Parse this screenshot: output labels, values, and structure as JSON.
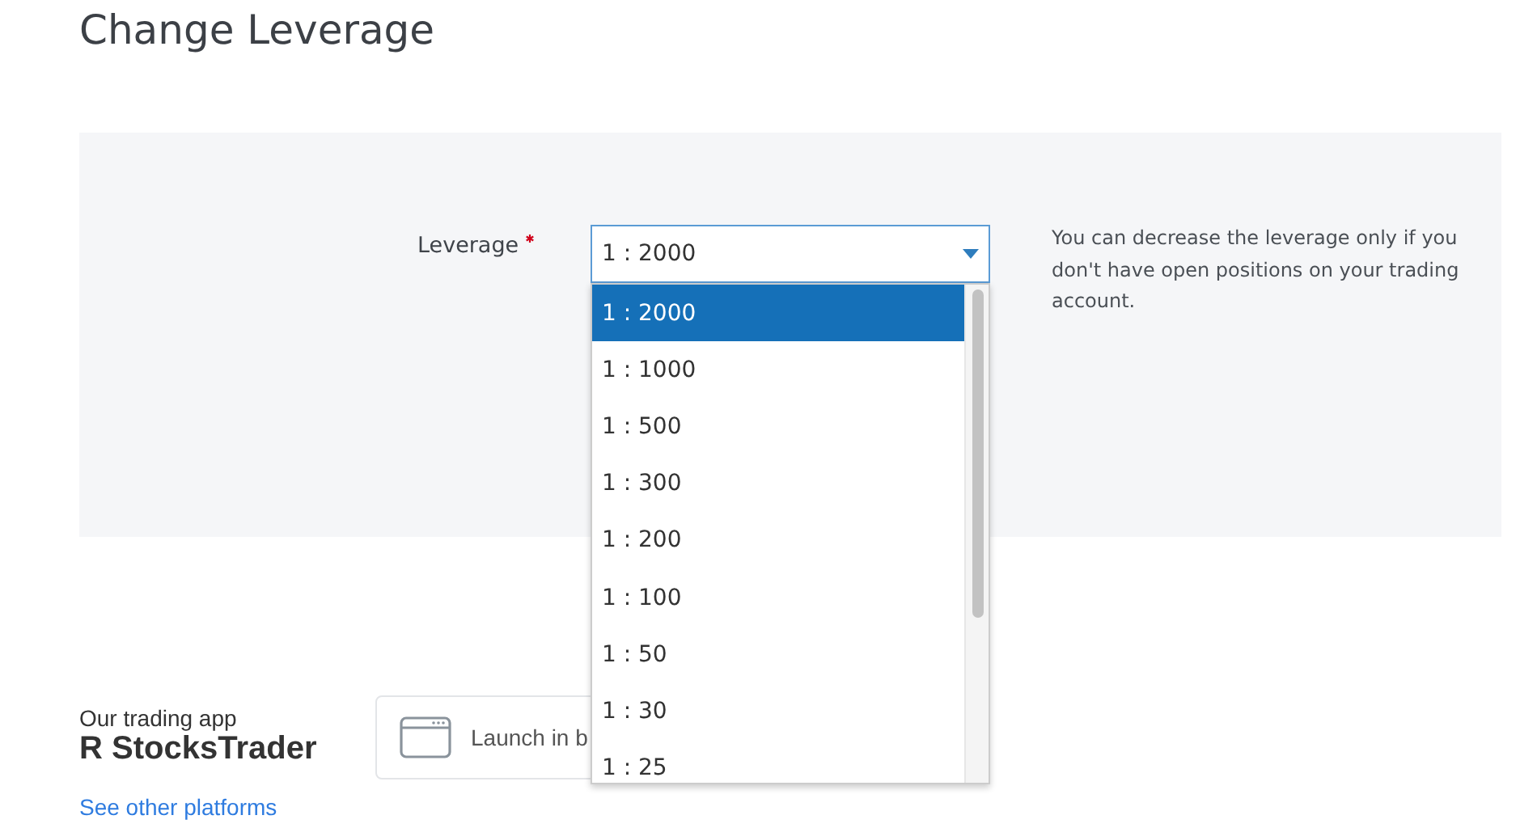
{
  "page": {
    "title": "Change Leverage"
  },
  "form": {
    "label": "Leverage",
    "required": true,
    "value": "1 : 2000",
    "help": "You can decrease the leverage only if you don't have open positions on your trading account.",
    "options": [
      {
        "label": "1 : 2000",
        "selected": true
      },
      {
        "label": "1 : 1000",
        "selected": false
      },
      {
        "label": "1 : 500",
        "selected": false
      },
      {
        "label": "1 : 300",
        "selected": false
      },
      {
        "label": "1 : 200",
        "selected": false
      },
      {
        "label": "1 : 100",
        "selected": false
      },
      {
        "label": "1 : 50",
        "selected": false
      },
      {
        "label": "1 : 30",
        "selected": false
      },
      {
        "label": "1 : 25",
        "selected": false
      }
    ]
  },
  "app": {
    "caption": "Our trading app",
    "name": "R StocksTrader",
    "launch": "Launch in b",
    "link": "See other platforms"
  }
}
